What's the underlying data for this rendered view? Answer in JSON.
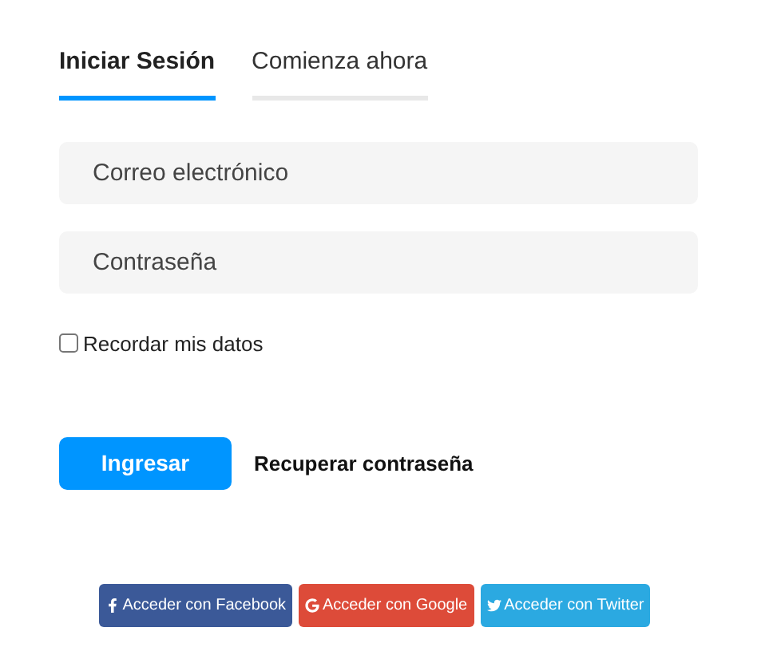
{
  "tabs": [
    {
      "label": "Iniciar Sesión",
      "selected": true
    },
    {
      "label": "Comienza ahora",
      "selected": false
    }
  ],
  "fields": [
    {
      "placeholder": "Correo electrónico"
    },
    {
      "placeholder": "Contraseña"
    }
  ],
  "remember": {
    "label": "Recordar mis datos",
    "checked": false
  },
  "submit": "Ingresar",
  "recover_link": "Recuperar contraseña",
  "social_buttons": [
    {
      "label": "Acceder con Facebook",
      "kind": "facebook",
      "color": "#3b5998"
    },
    {
      "label": "Acceder con Google",
      "kind": "google",
      "color": "#dd4b39"
    },
    {
      "label": "Acceder con Twitter",
      "kind": "twitter",
      "color": "#2ba9e1"
    }
  ]
}
